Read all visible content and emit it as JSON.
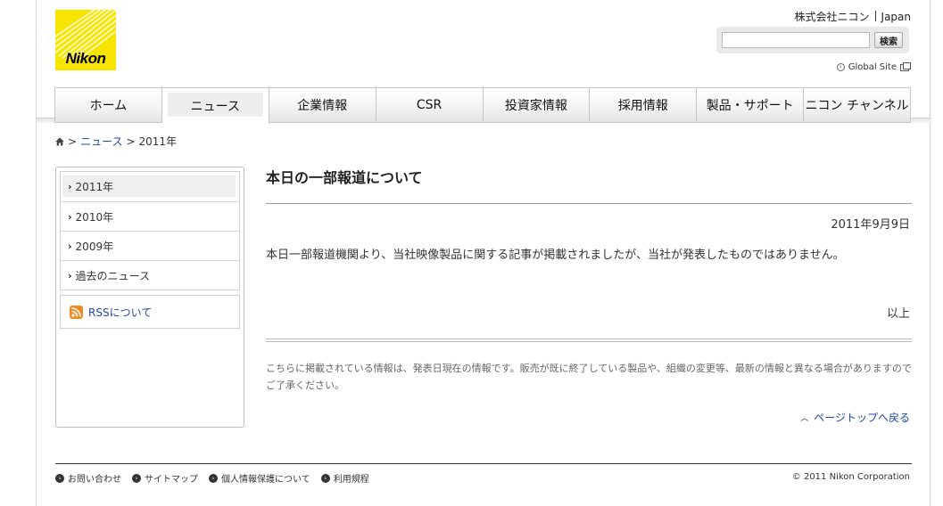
{
  "header": {
    "logo_text": "Nikon",
    "corp_name": "株式会社ニコン",
    "region": "Japan",
    "search_button": "検索",
    "search_placeholder": "",
    "global_site": "Global Site"
  },
  "nav": {
    "tabs": [
      {
        "label": "ホーム"
      },
      {
        "label": "ニュース"
      },
      {
        "label": "企業情報"
      },
      {
        "label": "CSR"
      },
      {
        "label": "投資家情報"
      },
      {
        "label": "採用情報"
      },
      {
        "label": "製品・サポート"
      },
      {
        "label": "ニコン チャンネル"
      }
    ]
  },
  "breadcrumb": {
    "sep1": ">",
    "news": "ニュース",
    "sep2": ">",
    "current": "2011年"
  },
  "sidebar": {
    "items": [
      {
        "label": "2011年"
      },
      {
        "label": "2010年"
      },
      {
        "label": "2009年"
      },
      {
        "label": "過去のニュース"
      }
    ],
    "rss_label": "RSSについて"
  },
  "article": {
    "title": "本日の一部報道について",
    "date": "2011年9月9日",
    "body": "本日一部報道機関より、当社映像製品に関する記事が掲載されましたが、当社が発表したものではありません。",
    "closing": "以上",
    "note": "こちらに掲載されている情報は、発表日現在の情報です。販売が既に終了している製品や、組織の変更等、最新の情報と異なる場合がありますのでご了承ください。",
    "page_top": "ページトップへ戻る"
  },
  "footer": {
    "links": [
      {
        "label": "お問い合わせ"
      },
      {
        "label": "サイトマップ"
      },
      {
        "label": "個人情報保護について"
      },
      {
        "label": "利用規程"
      }
    ],
    "copyright": "© 2011 Nikon Corporation"
  },
  "colors": {
    "logo_yellow": "#f7e400",
    "link_blue": "#1f4aa0",
    "rss_orange": "#f08a24"
  }
}
